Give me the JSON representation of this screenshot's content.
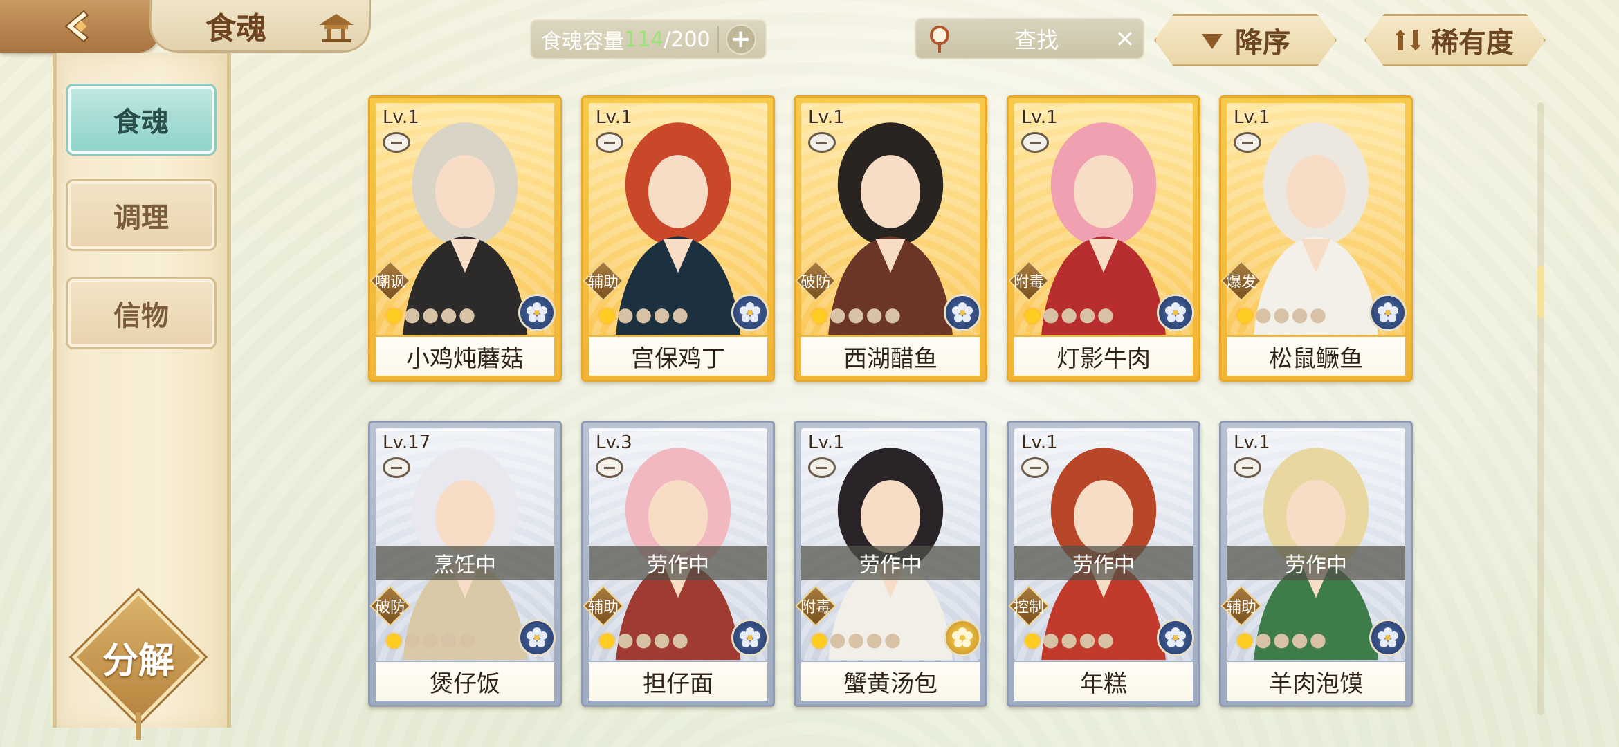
{
  "header": {
    "title": "食魂",
    "capacity_label": "食魂容量",
    "capacity_current": "114",
    "capacity_total": "/200",
    "search_placeholder": "查找",
    "sort_label": "降序",
    "rarity_label": "稀有度"
  },
  "sidebar": {
    "tabs": [
      {
        "label": "食魂",
        "active": true
      },
      {
        "label": "调理",
        "active": false
      },
      {
        "label": "信物",
        "active": false
      }
    ],
    "decompose_label": "分解"
  },
  "cards": [
    {
      "level": "Lv.1",
      "name": "小鸡炖蘑菇",
      "role": "嘲讽",
      "rarity": "gold",
      "status": "",
      "stars": 1,
      "element": "blue"
    },
    {
      "level": "Lv.1",
      "name": "宫保鸡丁",
      "role": "辅助",
      "rarity": "gold",
      "status": "",
      "stars": 1,
      "element": "blue"
    },
    {
      "level": "Lv.1",
      "name": "西湖醋鱼",
      "role": "破防",
      "rarity": "gold",
      "status": "",
      "stars": 1,
      "element": "blue"
    },
    {
      "level": "Lv.1",
      "name": "灯影牛肉",
      "role": "附毒",
      "rarity": "gold",
      "status": "",
      "stars": 1,
      "element": "blue"
    },
    {
      "level": "Lv.1",
      "name": "松鼠鳜鱼",
      "role": "爆发",
      "rarity": "gold",
      "status": "",
      "stars": 1,
      "element": "blue"
    },
    {
      "level": "Lv.17",
      "name": "煲仔饭",
      "role": "破防",
      "rarity": "silver",
      "status": "烹饪中",
      "stars": 1,
      "element": "blue"
    },
    {
      "level": "Lv.3",
      "name": "担仔面",
      "role": "辅助",
      "rarity": "silver",
      "status": "劳作中",
      "stars": 1,
      "element": "blue"
    },
    {
      "level": "Lv.1",
      "name": "蟹黄汤包",
      "role": "附毒",
      "rarity": "silver",
      "status": "劳作中",
      "stars": 1,
      "element": "gold"
    },
    {
      "level": "Lv.1",
      "name": "年糕",
      "role": "控制",
      "rarity": "silver",
      "status": "劳作中",
      "stars": 1,
      "element": "blue"
    },
    {
      "level": "Lv.1",
      "name": "羊肉泡馍",
      "role": "辅助",
      "rarity": "silver",
      "status": "劳作中",
      "stars": 1,
      "element": "blue"
    }
  ],
  "colors": {
    "gold_frame": "#f2b435",
    "silver_frame": "#9eaac0",
    "active_tab": "#8fd3cb",
    "capacity_current": "#9ce27a"
  },
  "icons": {
    "back": "back-arrow-icon",
    "home": "pavilion-icon",
    "search": "magnifier-icon",
    "clear": "close-icon",
    "sort": "triangle-down-icon",
    "rarity": "swap-arrows-icon"
  }
}
